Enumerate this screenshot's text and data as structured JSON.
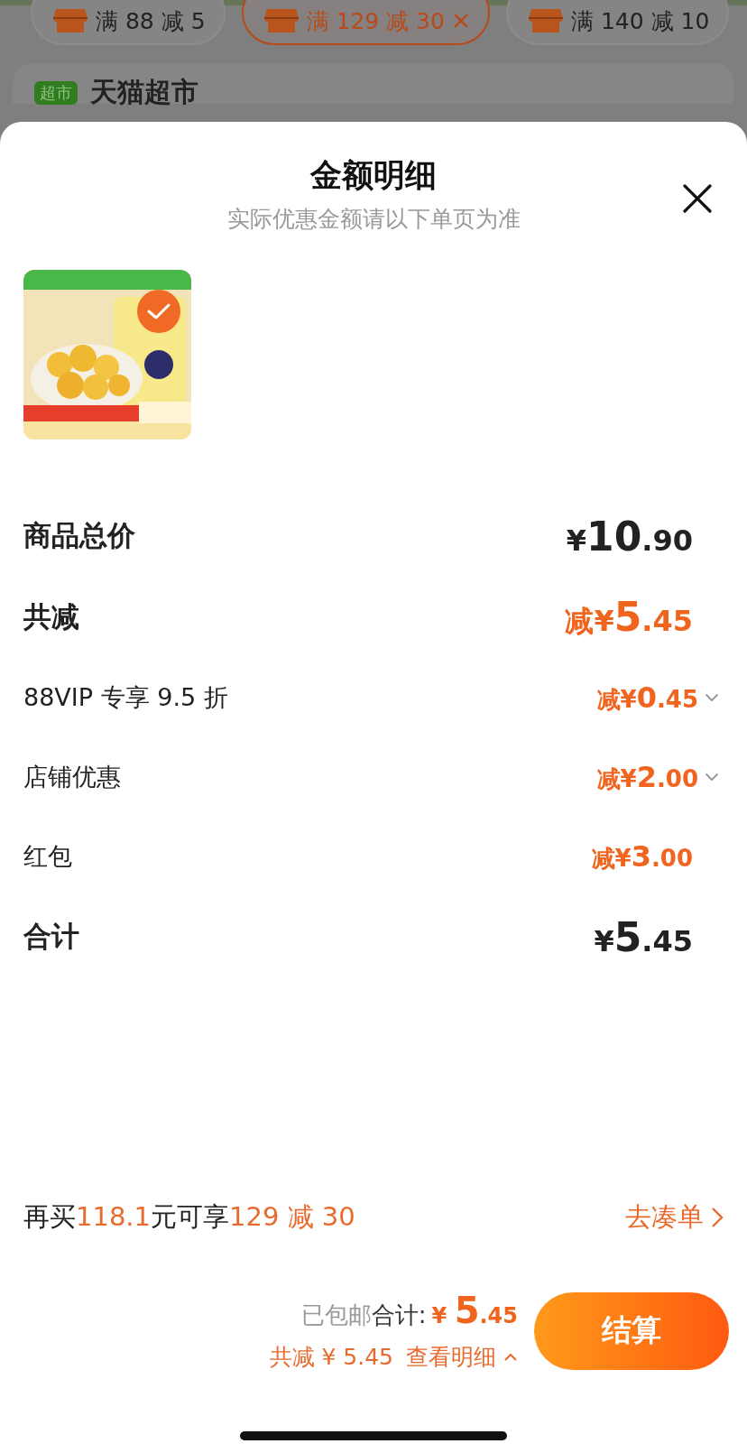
{
  "coupon_chips": [
    {
      "label": "满 88 减 5",
      "selected": false
    },
    {
      "label": "满 129 减 30",
      "selected": true,
      "removable": true
    },
    {
      "label": "满 140 减 10",
      "selected": false
    }
  ],
  "store": {
    "badge": "超市",
    "name": "天猫超市"
  },
  "sheet": {
    "title": "金额明细",
    "subtitle": "实际优惠金额请以下单页为准",
    "product": {
      "kind": "picture",
      "checked": true
    },
    "rows": [
      {
        "kind": "main",
        "label": "商品总价",
        "currency": "¥",
        "amount": "10.90",
        "discount": false
      },
      {
        "kind": "main",
        "label": "共减",
        "prefix": "减",
        "currency": "¥",
        "amount": "5.45",
        "discount": true
      },
      {
        "kind": "sub",
        "label": "88VIP 专享 9.5 折",
        "prefix": "减",
        "currency": "¥",
        "amount": "0.45",
        "discount": true,
        "expandable": true
      },
      {
        "kind": "sub",
        "label": "店铺优惠",
        "prefix": "减",
        "currency": "¥",
        "amount": "2.00",
        "discount": true,
        "expandable": true
      },
      {
        "kind": "sub",
        "label": "红包",
        "prefix": "减",
        "currency": "¥",
        "amount": "3.00",
        "discount": true,
        "expandable": false
      },
      {
        "kind": "main",
        "label": "合计",
        "currency": "¥",
        "amount": "5.45",
        "discount": false
      }
    ]
  },
  "promo": {
    "segments": [
      {
        "text": "再买",
        "highlight": false
      },
      {
        "text": "118.1",
        "highlight": true
      },
      {
        "text": "元可享",
        "highlight": false
      },
      {
        "text": "129 减 30",
        "highlight": true
      }
    ],
    "link": "去凑单"
  },
  "footer": {
    "shipping": "已包邮",
    "total_label": "合计:",
    "currency": "¥",
    "amount": "5.45",
    "discount_text": "共减 ¥ 5.45",
    "details_link": "查看明细",
    "checkout": "结算"
  }
}
